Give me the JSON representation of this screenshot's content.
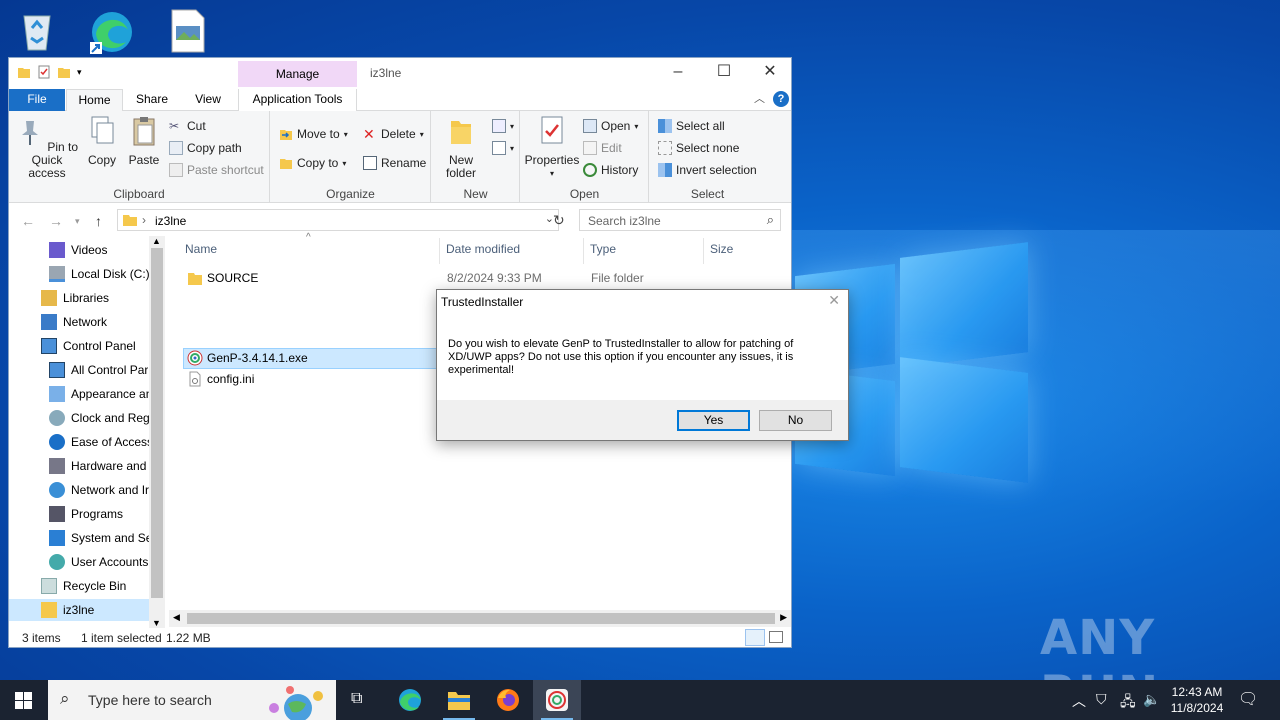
{
  "desktop": {
    "watermark": "ANY RUN"
  },
  "explorer": {
    "title": "iz3lne",
    "manage_tab": "Manage",
    "tabs": [
      "File",
      "Home",
      "Share",
      "View",
      "Application Tools"
    ],
    "ribbon": {
      "clipboard": {
        "label": "Clipboard",
        "pin": "Pin to Quick access",
        "copy": "Copy",
        "paste": "Paste",
        "cut": "Cut",
        "copy_path": "Copy path",
        "paste_shortcut": "Paste shortcut"
      },
      "organize": {
        "label": "Organize",
        "move_to": "Move to",
        "copy_to": "Copy to",
        "delete": "Delete",
        "rename": "Rename"
      },
      "new": {
        "label": "New",
        "new_folder": "New folder"
      },
      "open": {
        "label": "Open",
        "properties": "Properties",
        "open": "Open",
        "edit": "Edit",
        "history": "History"
      },
      "select": {
        "label": "Select",
        "select_all": "Select all",
        "select_none": "Select none",
        "invert_selection": "Invert selection"
      }
    },
    "address": "iz3lne",
    "search_placeholder": "Search iz3lne",
    "nav_items": [
      "Videos",
      "Local Disk (C:)",
      "Libraries",
      "Network",
      "Control Panel",
      "All Control Par",
      "Appearance an",
      "Clock and Regi",
      "Ease of Access",
      "Hardware and",
      "Network and Ir",
      "Programs",
      "System and Sec",
      "User Accounts",
      "Recycle Bin",
      "iz3lne"
    ],
    "columns": [
      "Name",
      "Date modified",
      "Type",
      "Size"
    ],
    "files": [
      {
        "name": "SOURCE",
        "date": "8/2/2024 9:33 PM",
        "type": "File folder",
        "size": ""
      },
      {
        "name": "GenP-3.4.14.1.exe",
        "date": "",
        "type": "",
        "size": ""
      },
      {
        "name": "config.ini",
        "date": "",
        "type": "",
        "size": ""
      }
    ],
    "status": {
      "items": "3 items",
      "selected": "1 item selected",
      "size": "1.22 MB"
    }
  },
  "dialog": {
    "title": "TrustedInstaller",
    "message": "Do you wish to elevate GenP to TrustedInstaller to allow for patching of XD/UWP apps? Do not use this option if you encounter any issues, it is experimental!",
    "yes": "Yes",
    "no": "No"
  },
  "taskbar": {
    "search_placeholder": "Type here to search",
    "time": "12:43 AM",
    "date": "11/8/2024"
  }
}
